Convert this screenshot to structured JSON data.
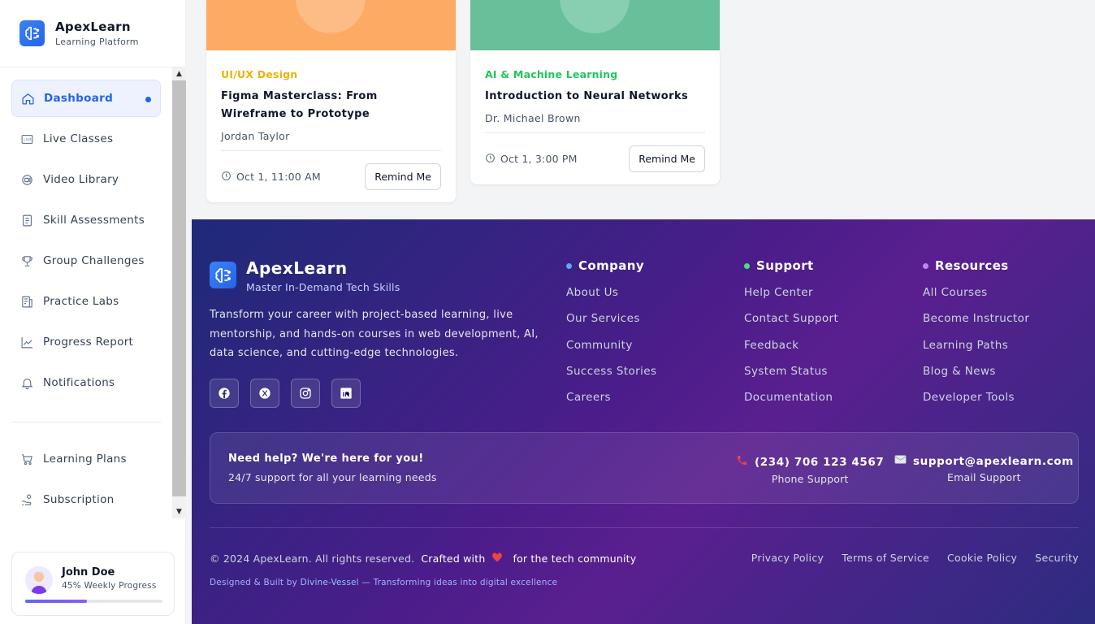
{
  "sidebar": {
    "brand": {
      "name": "ApexLearn",
      "subtitle": "Learning Platform"
    },
    "nav": [
      {
        "label": "Dashboard",
        "icon": "home-icon",
        "active": true
      },
      {
        "label": "Live Classes",
        "icon": "live-icon"
      },
      {
        "label": "Video Library",
        "icon": "video-icon"
      },
      {
        "label": "Skill Assessments",
        "icon": "clipboard-icon"
      },
      {
        "label": "Group Challenges",
        "icon": "trophy-icon"
      },
      {
        "label": "Practice Labs",
        "icon": "lab-icon"
      },
      {
        "label": "Progress Report",
        "icon": "chart-icon"
      },
      {
        "label": "Notifications",
        "icon": "bell-icon"
      }
    ],
    "nav_secondary": [
      {
        "label": "Learning Plans",
        "icon": "cart-icon"
      },
      {
        "label": "Subscription",
        "icon": "hand-coins-icon"
      }
    ],
    "user": {
      "name": "John Doe",
      "progress_text": "45% Weekly Progress",
      "progress": 0.45
    }
  },
  "cards": [
    {
      "category": "UI/UX Design",
      "category_color": "#eab308",
      "banner_color": "#fdaa63",
      "title": "Figma Masterclass: From Wireframe to Prototype",
      "instructor": "Jordan Taylor",
      "time": "Oct 1, 11:00 AM",
      "button": "Remind Me"
    },
    {
      "category": "AI & Machine Learning",
      "category_color": "#22c55e",
      "banner_color": "#67c09a",
      "title": "Introduction to Neural Networks",
      "instructor": "Dr. Michael Brown",
      "time": "Oct 1, 3:00 PM",
      "button": "Remind Me"
    }
  ],
  "footer": {
    "brand": {
      "name": "ApexLearn",
      "tagline": "Master In-Demand Tech Skills"
    },
    "description": "Transform your career with project-based learning, live mentorship, and hands-on courses in web development, AI, data science, and cutting-edge technologies.",
    "socials": [
      "facebook-icon",
      "x-icon",
      "instagram-icon",
      "linkedin-icon"
    ],
    "columns": [
      {
        "title": "Company",
        "bullet_color": "#60a5fa",
        "links": [
          "About Us",
          "Our Services",
          "Community",
          "Success Stories",
          "Careers"
        ]
      },
      {
        "title": "Support",
        "bullet_color": "#4ade80",
        "links": [
          "Help Center",
          "Contact Support",
          "Feedback",
          "System Status",
          "Documentation"
        ]
      },
      {
        "title": "Resources",
        "bullet_color": "#c084fc",
        "links": [
          "All Courses",
          "Become Instructor",
          "Learning Paths",
          "Blog & News",
          "Developer Tools"
        ]
      }
    ],
    "help": {
      "title": "Need help? We're here for you!",
      "subtitle": "24/7 support for all your learning needs",
      "phone": "(234) 706 123 4567",
      "phone_label": "Phone Support",
      "email": "support@apexlearn.com",
      "email_label": "Email Support"
    },
    "copyright": "© 2024 ApexLearn. All rights reserved.",
    "crafted_prefix": "Crafted with",
    "crafted_suffix": "for the tech community",
    "credit_prefix": "Designed & Built by",
    "credit_link": "Divine-Vessel",
    "credit_suffix": "— Transforming ideas into digital excellence",
    "legal": [
      "Privacy Policy",
      "Terms of Service",
      "Cookie Policy",
      "Security"
    ]
  }
}
